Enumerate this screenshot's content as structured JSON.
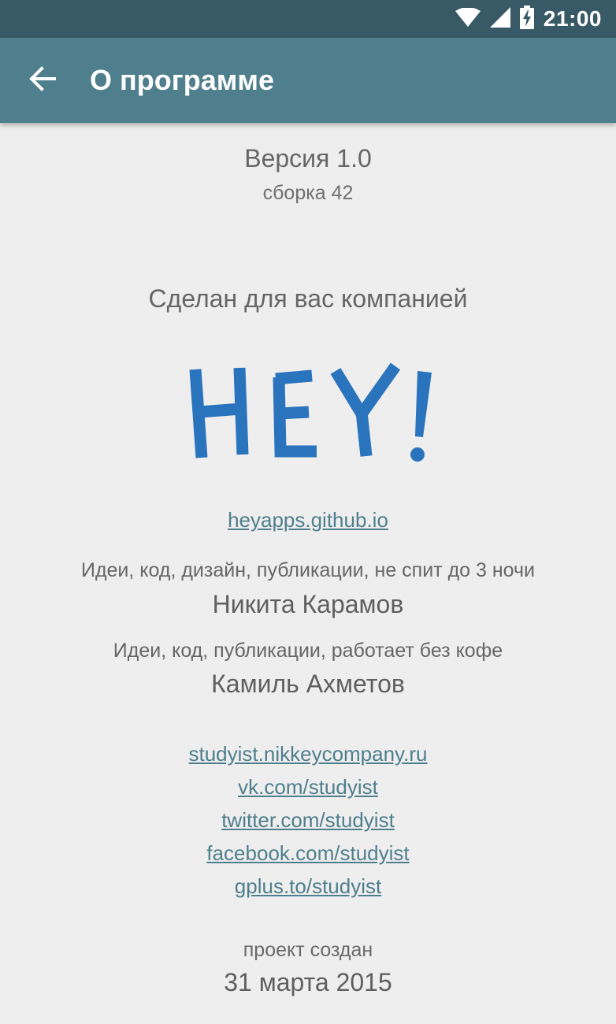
{
  "status_bar": {
    "time": "21:00",
    "icons": [
      "wifi-icon",
      "cell-signal-icon",
      "battery-charging-icon"
    ]
  },
  "app_bar": {
    "title": "О программе",
    "back_icon": "arrow-back-icon"
  },
  "version": {
    "label": "Версия 1.0",
    "build": "сборка 42"
  },
  "company": {
    "made_by": "Сделан для вас компанией",
    "logo_text": "HEY!",
    "site": "heyapps.github.io"
  },
  "team": [
    {
      "role": "Идеи, код, дизайн, публикации, не спит до 3 ночи",
      "name": "Никита Карамов"
    },
    {
      "role": "Идеи, код, публикации, работает без кофе",
      "name": "Камиль Ахметов"
    }
  ],
  "links": [
    "studyist.nikkeycompany.ru",
    "vk.com/studyist",
    "twitter.com/studyist",
    "facebook.com/studyist",
    "gplus.to/studyist"
  ],
  "created": {
    "label": "проект создан",
    "date": "31 марта 2015"
  },
  "colors": {
    "status_bar": "#385966",
    "app_bar": "#4f7f8d",
    "background": "#eeeeee",
    "logo": "#2a73bd",
    "link": "#4f7f8d"
  }
}
